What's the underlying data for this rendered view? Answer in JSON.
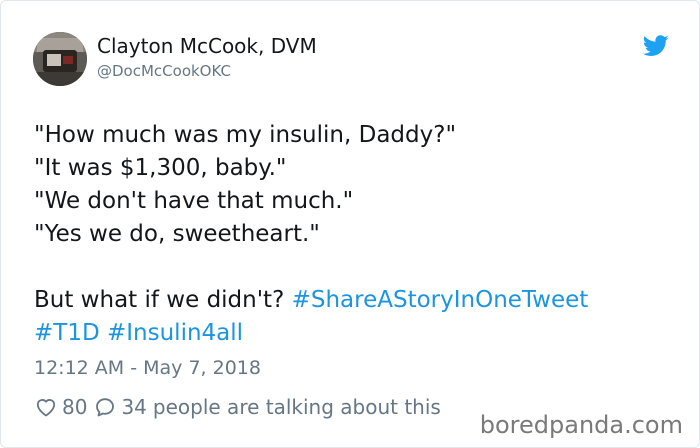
{
  "author": {
    "name": "Clayton McCook, DVM",
    "handle": "@DocMcCookOKC"
  },
  "tweet": {
    "lines": [
      "\"How much was my insulin, Daddy?\"",
      "\"It was $1,300, baby.\"",
      "\"We don't have that much.\"",
      "\"Yes we do, sweetheart.\""
    ],
    "line5_text": "But what if we didn't? ",
    "hashtag_1": "#ShareAStoryInOneTweet",
    "hashtag_2": "#T1D",
    "hashtag_3": "#Insulin4all",
    "timestamp": "12:12 AM - May 7, 2018"
  },
  "actions": {
    "likes": "80",
    "replies": "34",
    "talking_text": "people are talking about this"
  },
  "watermark": "boredpanda.com",
  "colors": {
    "text": "#14171a",
    "secondary": "#657786",
    "hashtag": "#1b95e0",
    "twitter_blue": "#1da1f2"
  },
  "icons": {
    "brand": "twitter-bird-icon",
    "like": "heart-icon",
    "reply": "speech-bubble-icon"
  }
}
